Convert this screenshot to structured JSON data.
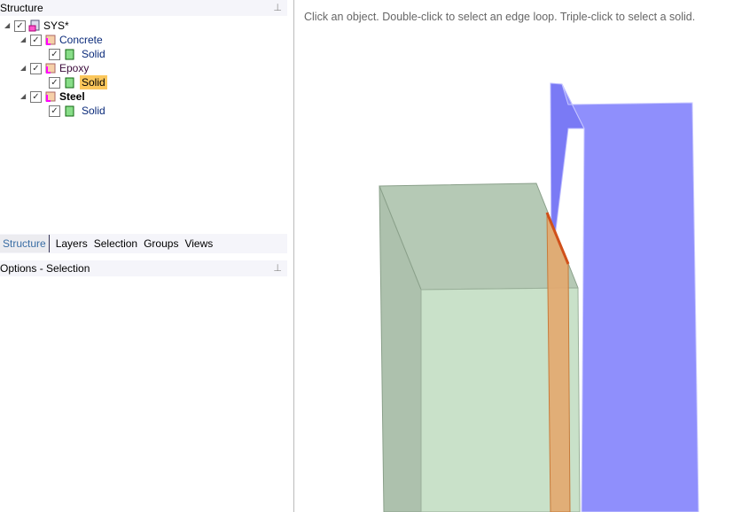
{
  "structure_panel": {
    "title": "Structure",
    "pin": "pin-icon",
    "tree": [
      {
        "label": "SYS*",
        "level": 0
      },
      {
        "label": "Concrete",
        "level": 1
      },
      {
        "label": "Solid",
        "level": 2
      },
      {
        "label": "Epoxy",
        "level": 1
      },
      {
        "label": "Solid",
        "level": 2,
        "selected": true
      },
      {
        "label": "Steel",
        "level": 1,
        "bold": true
      },
      {
        "label": "Solid",
        "level": 2
      }
    ]
  },
  "tabs": [
    "Structure",
    "Layers",
    "Selection",
    "Groups",
    "Views"
  ],
  "options_panel": {
    "title": "Options - Selection"
  },
  "viewport": {
    "hint": "Click an object. Double-click to select an edge loop. Triple-click to select a solid.",
    "colors": {
      "concrete": "#c9e1c9",
      "epoxy": "#e3a86e",
      "steel": "#8f8ffc"
    }
  }
}
